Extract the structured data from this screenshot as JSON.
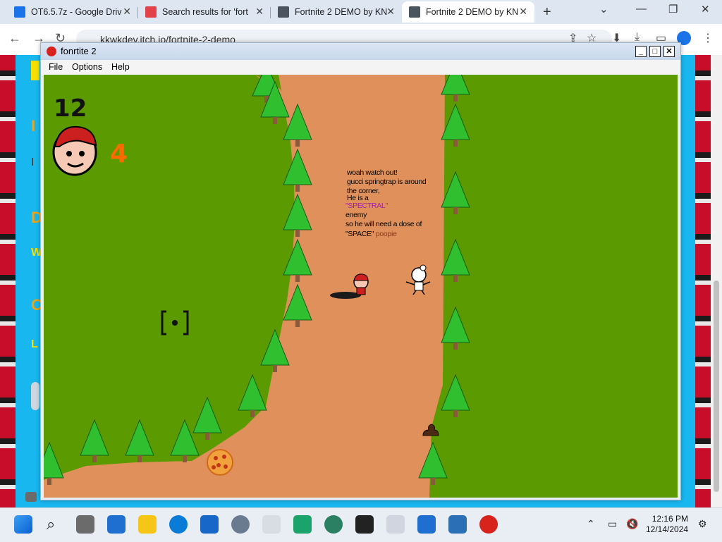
{
  "browser": {
    "tabs": [
      {
        "title": "OT6.5.7z - Google Driv",
        "favicon_color": "#1a73e8"
      },
      {
        "title": "Search results for 'fort",
        "favicon_color": "#e2434b"
      },
      {
        "title": "Fortnite 2 DEMO by KN",
        "favicon_color": "#4a5560"
      },
      {
        "title": "Fortnite 2 DEMO by KN",
        "favicon_color": "#4a5560"
      }
    ],
    "new_tab_label": "+",
    "url": "kkwkdev.itch.io/fortnite-2-demo"
  },
  "game_window": {
    "title": "fonrtite 2",
    "menu": [
      "File",
      "Options",
      "Help"
    ],
    "controls": {
      "minimize": "_",
      "maximize": "□",
      "close": "✕"
    }
  },
  "hud": {
    "score": "12",
    "lives": "4"
  },
  "dialog": {
    "lines": [
      "woah watch out!",
      "gucci springtrap is around",
      "the corner,",
      "He is a"
    ],
    "spectral": "\"SPECTRAL\"",
    "after": [
      "enemy",
      "so he will need a dose of"
    ],
    "space": "\"SPACE\"",
    "poopie": "poopie"
  },
  "taskbar": {
    "time": "12:16 PM",
    "date": "12/14/2024"
  },
  "colors": {
    "grass": "#5b9a00",
    "path": "#e0905a",
    "tree": "#2fbf2f",
    "trunk": "#8a5a3c",
    "lives_accent": "#ff6a00",
    "spectral": "#a020a0",
    "poopie": "#8b3a1a"
  }
}
